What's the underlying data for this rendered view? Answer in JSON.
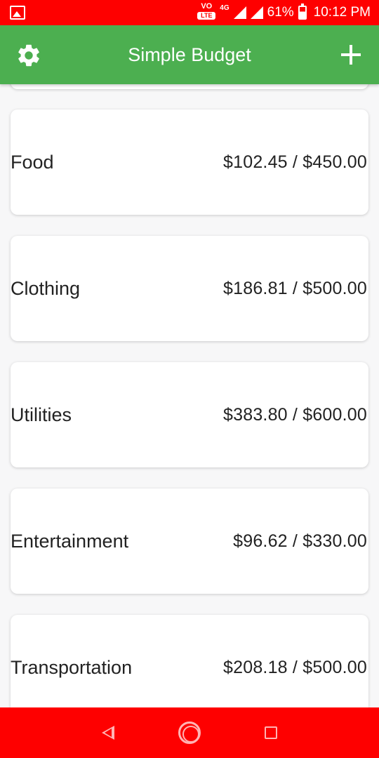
{
  "status_bar": {
    "volte": "VO",
    "lte": "LTE",
    "network": "4G",
    "battery": "61%",
    "time": "10:12 PM"
  },
  "app_bar": {
    "title": "Simple Budget",
    "left_icon": "gear-icon",
    "right_icon": "plus-icon"
  },
  "budgets": [
    {
      "name": "Food",
      "amount": "$102.45 / $450.00"
    },
    {
      "name": "Clothing",
      "amount": "$186.81 / $500.00"
    },
    {
      "name": "Utilities",
      "amount": "$383.80 / $600.00"
    },
    {
      "name": "Entertainment",
      "amount": "$96.62 / $330.00"
    },
    {
      "name": "Transportation",
      "amount": "$208.18 / $500.00"
    }
  ],
  "nav_bar": {
    "back_icon": "back-triangle-icon",
    "home_icon": "home-circle-icon",
    "recents_icon": "recents-square-icon"
  },
  "colors": {
    "status_bar": "#fe0000",
    "app_bar": "#4caf50",
    "nav_bar": "#fe0000",
    "background": "#f7f7f8"
  }
}
